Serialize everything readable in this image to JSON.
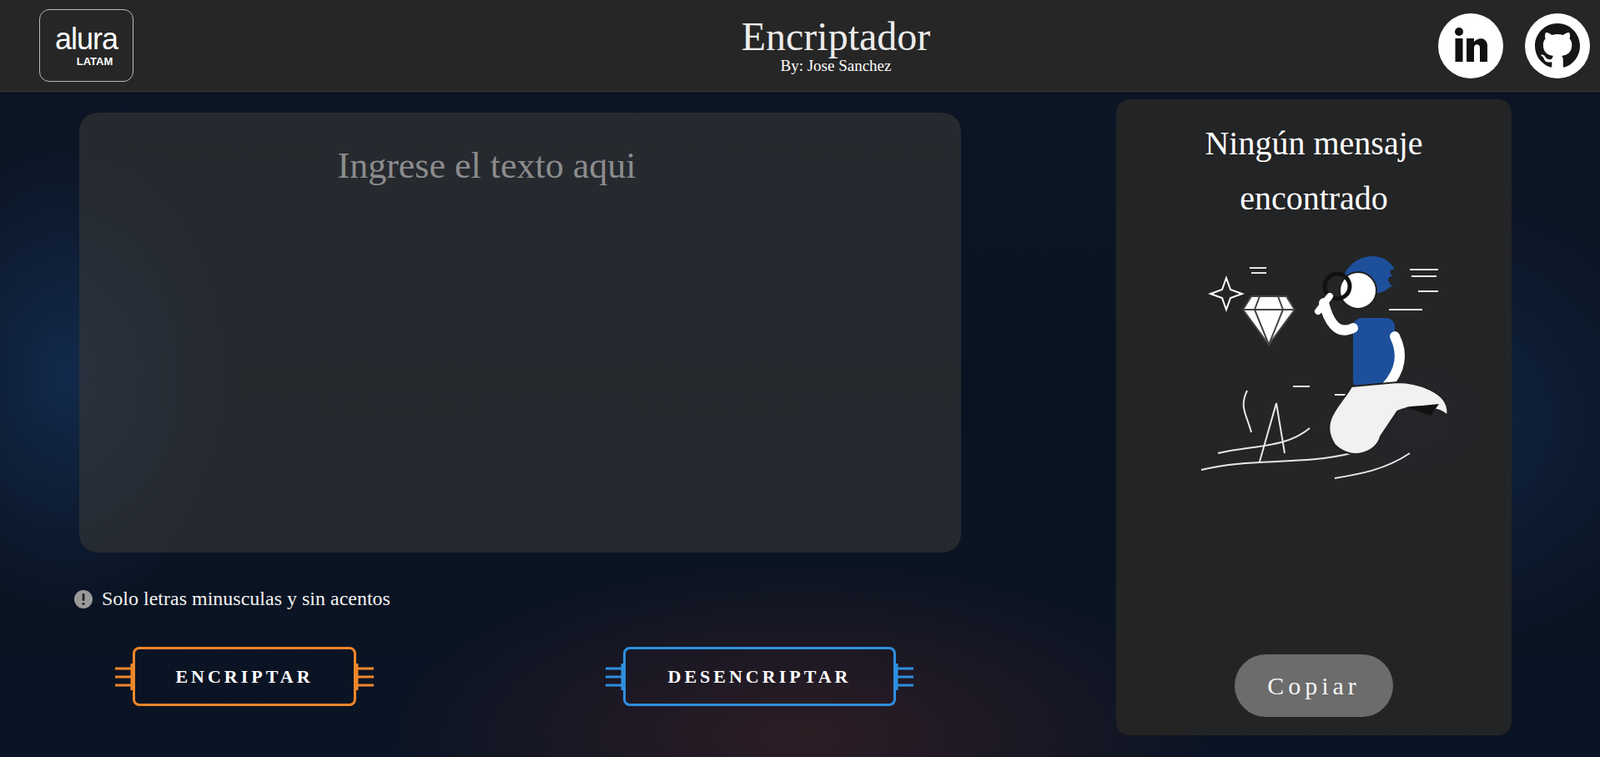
{
  "header": {
    "logo": {
      "brand": "alura",
      "region": "LATAM"
    },
    "title": "Encriptador",
    "subtitle": "By: Jose Sanchez"
  },
  "input": {
    "placeholder": "Ingrese el texto aqui",
    "value": ""
  },
  "hint": {
    "text": "Solo letras minusculas y sin acentos"
  },
  "actions": [
    {
      "label": "ENCRIPTAR",
      "color": "#f0862a"
    },
    {
      "label": "DESENCRIPTAR",
      "color": "#2f8fe0"
    }
  ],
  "output": {
    "title": "Ningún mensaje encontrado",
    "copy_button": {
      "label": "Copiar",
      "disabled": true
    }
  }
}
